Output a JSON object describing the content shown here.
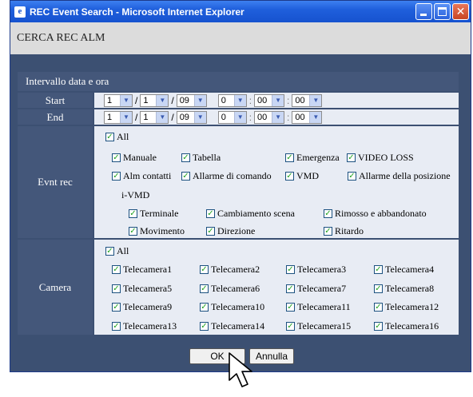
{
  "window": {
    "title": "REC Event Search - Microsoft Internet Explorer"
  },
  "page": {
    "header": "CERCA REC ALM"
  },
  "datetime": {
    "section_title": "Intervallo data e ora",
    "start": {
      "label": "Start",
      "year": "1",
      "month": "1",
      "day": "09",
      "hour": "0",
      "minute": "00",
      "second": "00"
    },
    "end": {
      "label": "End",
      "year": "1",
      "month": "1",
      "day": "09",
      "hour": "0",
      "minute": "00",
      "second": "00"
    },
    "sep_slash": "/",
    "sep_colon": ":"
  },
  "event": {
    "label": "Evnt rec",
    "all": "All",
    "manuale": "Manuale",
    "tabella": "Tabella",
    "emergenza": "Emergenza",
    "video_loss": "VIDEO LOSS",
    "alm_contatti": "Alm contatti",
    "allarme_comando": "Allarme di comando",
    "vmd": "VMD",
    "allarme_posizione": "Allarme della posizione",
    "ivmd": "i-VMD",
    "terminale": "Terminale",
    "cambiamento_scena": "Cambiamento scena",
    "rimosso": "Rimosso e abbandonato",
    "movimento": "Movimento",
    "direzione": "Direzione",
    "ritardo": "Ritardo"
  },
  "camera": {
    "label": "Camera",
    "all": "All",
    "cameras": [
      "Telecamera1",
      "Telecamera2",
      "Telecamera3",
      "Telecamera4",
      "Telecamera5",
      "Telecamera6",
      "Telecamera7",
      "Telecamera8",
      "Telecamera9",
      "Telecamera10",
      "Telecamera11",
      "Telecamera12",
      "Telecamera13",
      "Telecamera14",
      "Telecamera15",
      "Telecamera16"
    ]
  },
  "buttons": {
    "ok": "OK",
    "cancel": "Annulla"
  },
  "check_glyph": "✓",
  "colors": {
    "panel": "#3c5072",
    "label_bg": "#44577a",
    "value_bg": "#e8ecf4",
    "check": "#21a121",
    "titlebar": "#1f5fdc"
  }
}
